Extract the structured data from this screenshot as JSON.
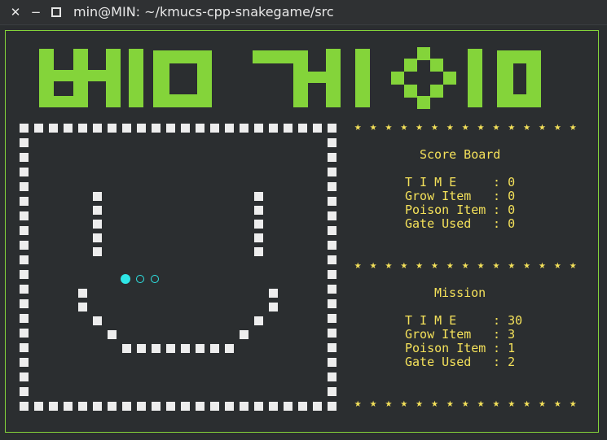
{
  "window": {
    "title": "min@MIN: ~/kmucs-cpp-snakegame/src",
    "close_glyph": "✕",
    "minimize_glyph": "−",
    "maximize_glyph": "▫"
  },
  "banner": {
    "text": "뱀 게임",
    "color": "#84d43a"
  },
  "score_board": {
    "title": "Score Board",
    "rows": [
      {
        "label": "T I M E",
        "value": "0"
      },
      {
        "label": "Grow Item",
        "value": "0"
      },
      {
        "label": "Poison Item",
        "value": "0"
      },
      {
        "label": "Gate Used",
        "value": "0"
      }
    ]
  },
  "mission": {
    "title": "Mission",
    "rows": [
      {
        "label": "T I M E",
        "value": "30"
      },
      {
        "label": "Grow Item",
        "value": "3"
      },
      {
        "label": "Poison Item",
        "value": "1"
      },
      {
        "label": "Gate Used",
        "value": "2"
      }
    ]
  },
  "star_row": "★ ★ ★ ★ ★ ★ ★ ★ ★ ★ ★ ★ ★ ★ ★",
  "colors": {
    "background": "#2b2e30",
    "wall": "#ededed",
    "snake": "#2ee6e6",
    "text": "#f4e15a",
    "frame": "#84d43a"
  }
}
